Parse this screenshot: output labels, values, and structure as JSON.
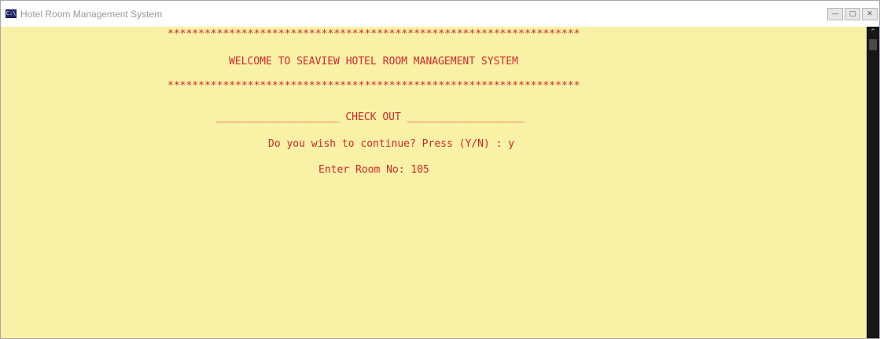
{
  "window": {
    "title": "Hotel Room Management System",
    "icon": "console-app-icon",
    "icon_glyph": "C:\\",
    "controls": {
      "minimize": "—",
      "maximize": "□",
      "close": "✕"
    }
  },
  "console": {
    "text_color": "#d4272d",
    "background_color": "#f9f1a5",
    "lines": {
      "stars_top": "*******************************************************************",
      "welcome": "WELCOME TO SEAVIEW HOTEL ROOM MANAGEMENT SYSTEM",
      "stars_bottom": "*******************************************************************",
      "section_header": "____________________ CHECK OUT ___________________",
      "continue_prompt": "Do you wish to continue? Press (Y/N) : y",
      "room_prompt": "Enter Room No: 105"
    }
  },
  "scrollbar": {
    "up_arrow": "⌃"
  }
}
